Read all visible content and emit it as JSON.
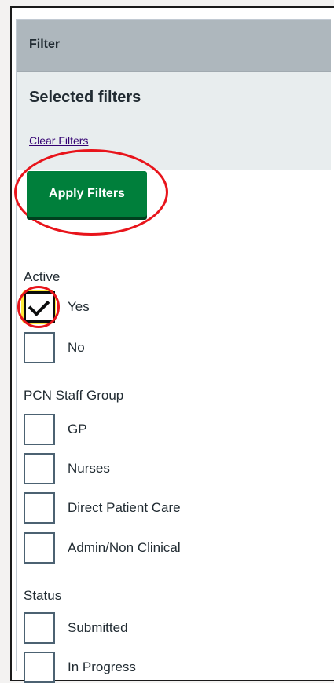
{
  "panel": {
    "header_label": "Filter",
    "selected_title": "Selected filters",
    "clear_link": "Clear Filters",
    "apply_label": "Apply Filters"
  },
  "groups": [
    {
      "label": "Active",
      "options": [
        {
          "label": "Yes",
          "checked": true
        },
        {
          "label": "No",
          "checked": false
        }
      ]
    },
    {
      "label": "PCN Staff Group",
      "options": [
        {
          "label": "GP",
          "checked": false
        },
        {
          "label": "Nurses",
          "checked": false
        },
        {
          "label": "Direct Patient Care",
          "checked": false
        },
        {
          "label": "Admin/Non Clinical",
          "checked": false
        }
      ]
    },
    {
      "label": "Status",
      "options": [
        {
          "label": "Submitted",
          "checked": false
        },
        {
          "label": "In Progress",
          "checked": false
        }
      ]
    }
  ],
  "colors": {
    "apply_button": "#007f3b",
    "highlight_ring": "#e8141b",
    "focus_yellow": "#ffeb3b",
    "link": "#330072"
  }
}
